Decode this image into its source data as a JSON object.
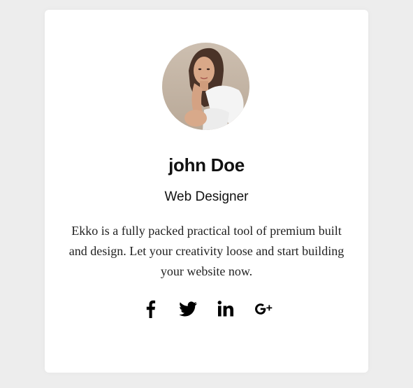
{
  "profile": {
    "name": "john Doe",
    "role": "Web Designer",
    "bio": "Ekko is a fully packed practical tool of premium built and design. Let your creativity loose and start building your website now."
  },
  "social": [
    {
      "icon": "facebook-icon"
    },
    {
      "icon": "twitter-icon"
    },
    {
      "icon": "linkedin-icon"
    },
    {
      "icon": "google-plus-icon"
    }
  ],
  "colors": {
    "background": "#ededed",
    "card": "#ffffff",
    "text": "#111111",
    "icon": "#000000"
  }
}
